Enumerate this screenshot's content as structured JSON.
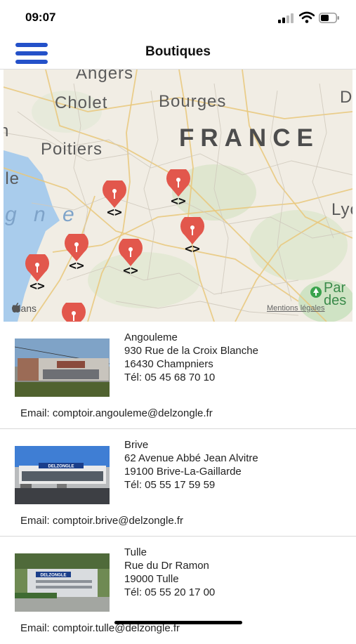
{
  "status_bar": {
    "time": "09:07"
  },
  "header": {
    "title": "Boutiques",
    "menu_icon": "hamburger-menu-icon"
  },
  "map": {
    "cities": [
      "Angers",
      "Cholet",
      "Bourges",
      "Poitiers",
      "Lyon"
    ],
    "country_label": "FRANCE",
    "sea_label": "g n e",
    "partial_labels": {
      "left_edge": "n",
      "left_city": "lle",
      "right_top": "D",
      "park": "Par\ndes"
    },
    "pin_label": "<>",
    "provider": "Plans",
    "legal": "Mentions légales",
    "pin_color": "#e2574c"
  },
  "stores": [
    {
      "name": "Angouleme",
      "street": "930 Rue de la Croix Blanche",
      "city": "16430 Champniers",
      "phone": "Tél: 05 45 68 70 10",
      "email": "Email: comptoir.angouleme@delzongle.fr"
    },
    {
      "name": "Brive",
      "street": "62 Avenue Abbé Jean Alvitre",
      "city": "19100 Brive-La-Gaillarde",
      "phone": "Tél: 05 55 17 59 59",
      "email": "Email: comptoir.brive@delzongle.fr"
    },
    {
      "name": "Tulle",
      "street": "Rue du Dr Ramon",
      "city": "19000 Tulle",
      "phone": "Tél: 05 55 20 17 00",
      "email": "Email: comptoir.tulle@delzongle.fr"
    }
  ],
  "photo_signs": [
    "DELZONGLE",
    "DELZONGLE"
  ],
  "colors": {
    "accent": "#2451c9",
    "pin": "#e2574c",
    "divider": "#d8d8d8"
  }
}
